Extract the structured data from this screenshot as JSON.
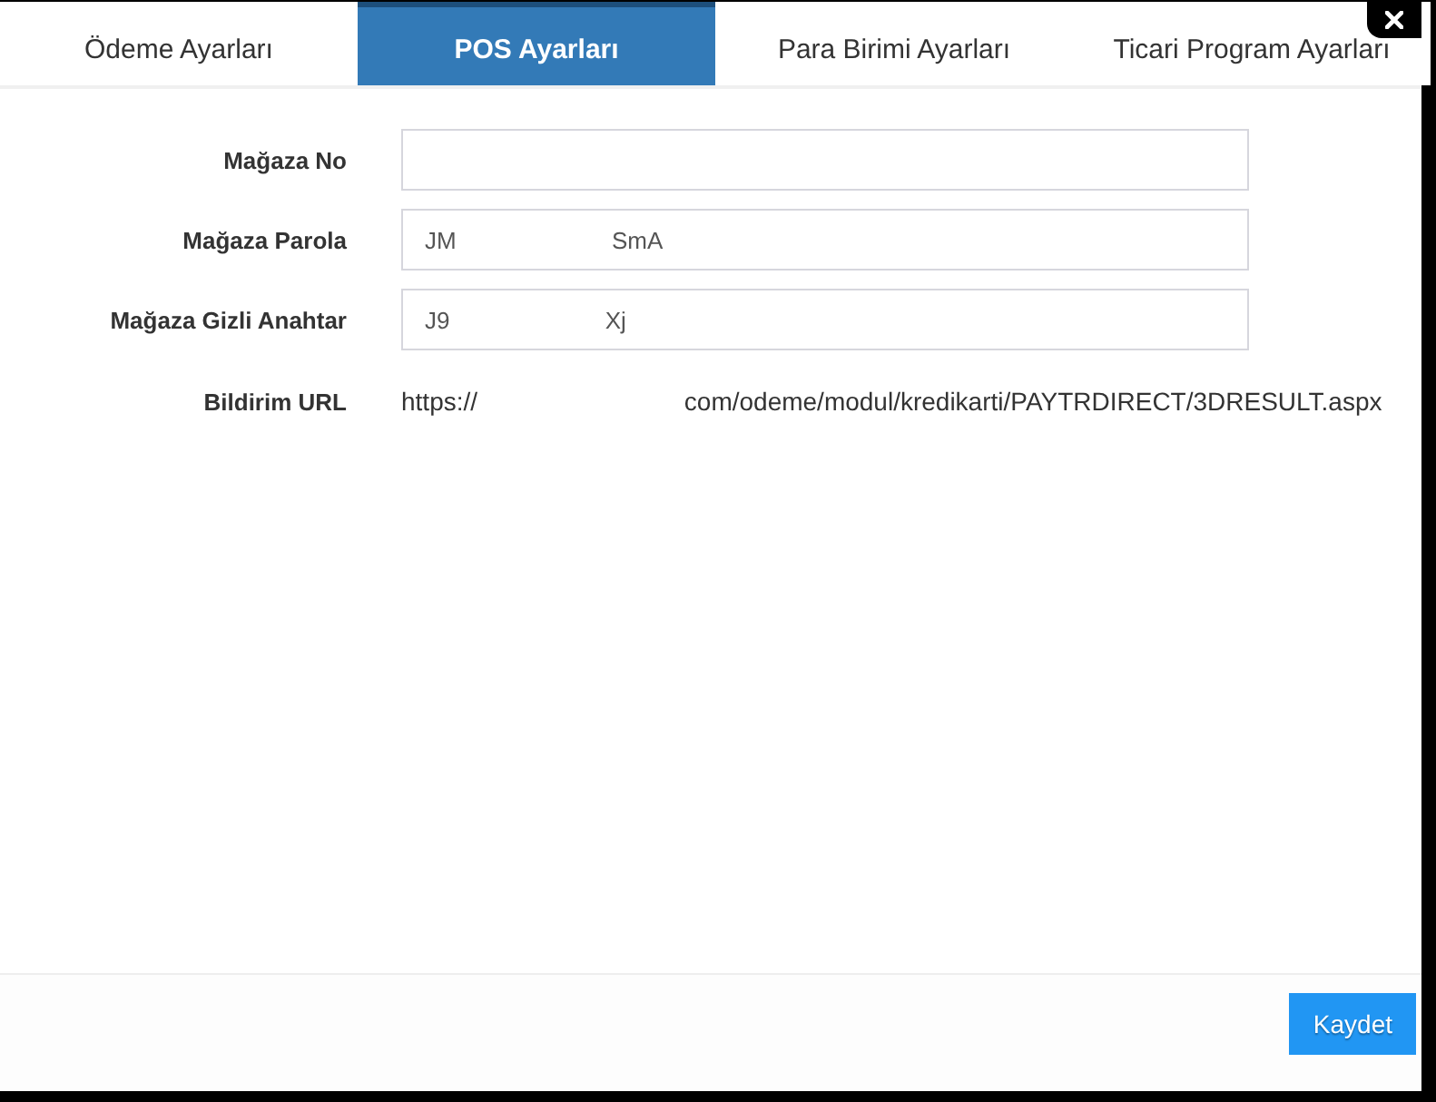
{
  "tabs": [
    {
      "label": "Ödeme Ayarları",
      "selected": false
    },
    {
      "label": "POS Ayarları",
      "selected": true
    },
    {
      "label": "Para Birimi Ayarları",
      "selected": false
    },
    {
      "label": "Ticari Program Ayarları",
      "selected": false
    }
  ],
  "form": {
    "fields": [
      {
        "kind": "input",
        "label": "Mağaza No"
      },
      {
        "kind": "input",
        "label": "Mağaza Parola",
        "value": "JM SmA"
      },
      {
        "kind": "input",
        "label": "Mağaza Gizli Anahtar",
        "value": "J9 Xj"
      },
      {
        "kind": "text",
        "label": "Bildirim URL",
        "value": "https:// com/odeme/modul/kredikarti/PAYTRDIRECT/3DRESULT.aspx"
      }
    ]
  },
  "footer": {
    "buttons": [
      "Kaydet"
    ]
  }
}
